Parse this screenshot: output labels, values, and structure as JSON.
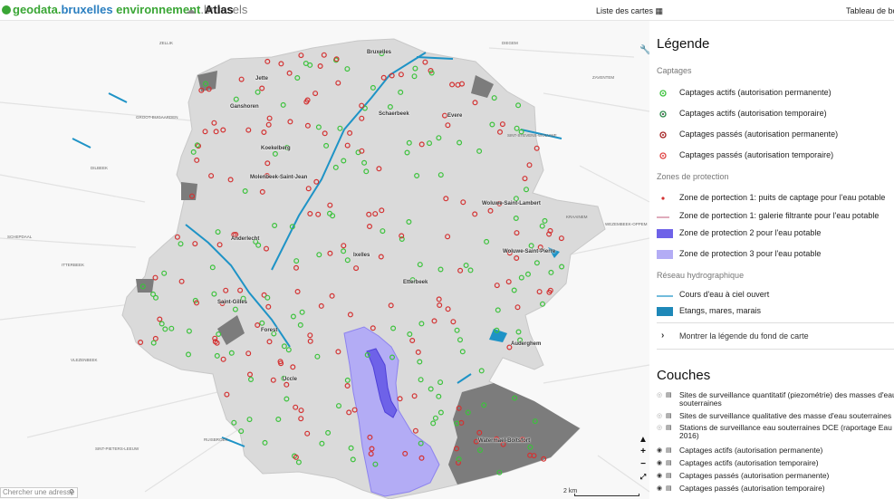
{
  "header": {
    "logo_parts": [
      "geodata.",
      "bruxelles",
      " environnement",
      ".brussels"
    ],
    "app_title": "Atlas",
    "map_list_label": "Liste des cartes",
    "dashboard_label": "Tableau de bord"
  },
  "map": {
    "search_placeholder": "Chercher une adresse",
    "scale_label": "2 km",
    "communes": [
      "Bruxelles",
      "Jette",
      "Ganshoren",
      "Koekelberg",
      "Molenbeek-Saint-Jean",
      "Schaerbeek",
      "Evere",
      "Anderlecht",
      "Saint-Gilles",
      "Ixelles",
      "Etterbeek",
      "Woluwe-Saint-Lambert",
      "Woluwe-Saint-Pierre",
      "Forest",
      "Uccle",
      "Auderghem",
      "Watermael-Boitsfort"
    ],
    "outer_towns": [
      "ZELLIK",
      "GROOT-BIJGAARDEN",
      "DILBEEK",
      "SCHEPDAAL",
      "ITTERBEEK",
      "VLEZENBEEK",
      "SINT-PIETERS-LEEUW",
      "RUISBROEK",
      "DIEGEM",
      "ZAVENTEM",
      "SINT-STEVENS-WOLUWE",
      "KRAAINEM",
      "WEZEMBEEK-OPPEM"
    ],
    "colors": {
      "region": "#dadada",
      "forest": "#7c7c7c",
      "water": "#1e93c6",
      "zone2": "#6e62e8",
      "zone3": "#b3acf5",
      "active": "#3cc23c",
      "past": "#d33232"
    }
  },
  "legend": {
    "title": "Légende",
    "captages": {
      "heading": "Captages",
      "items": [
        {
          "label": "Captages actifs (autorisation permanente)",
          "icon": "green-circle-dot"
        },
        {
          "label": "Captages actifs (autorisation temporaire)",
          "icon": "green-ring-dark-dot"
        },
        {
          "label": "Captages passés (autorisation permanente)",
          "icon": "red-ring-dot"
        },
        {
          "label": "Captages passés (autorisation temporaire)",
          "icon": "red-ring-dot-light"
        }
      ]
    },
    "zones": {
      "heading": "Zones de protection",
      "items": [
        {
          "label": "Zone de portection 1: puits de captage pour l'eau potable",
          "icon": "red-dot"
        },
        {
          "label": "Zone de portection 1: galerie filtrante pour l'eau potable",
          "icon": "pink-line"
        },
        {
          "label": "Zone de protection 2 pour l'eau potable",
          "icon": "purple-rect"
        },
        {
          "label": "Zone de protection 3 pour l'eau potable",
          "icon": "lilac-rect"
        }
      ]
    },
    "hydro": {
      "heading": "Réseau hydrographique",
      "items": [
        {
          "label": "Cours d'eau à ciel ouvert",
          "icon": "blue-line"
        },
        {
          "label": "Etangs, mares, marais",
          "icon": "blue-rect"
        }
      ]
    },
    "show_basemap_label": "Montrer la légende du fond de carte"
  },
  "layers": {
    "title": "Couches",
    "items": [
      {
        "label": "Sites de surveillance quantitatif (piezométrie) des masses d'eau souterraines",
        "visible": false
      },
      {
        "label": "Sites de surveillance qualitative des masse d'eau souterraines",
        "visible": false
      },
      {
        "label": "Stations de surveillance eau souterraines DCE (raportage Eau 2016)",
        "visible": false
      },
      {
        "label": "Captages actifs (autorisation permanente)",
        "visible": true
      },
      {
        "label": "Captages actifs (autorisation temporaire)",
        "visible": true
      },
      {
        "label": "Captages passés (autorisation permanente)",
        "visible": true
      },
      {
        "label": "Captages passés (autorisation temporaire)",
        "visible": true
      }
    ]
  }
}
